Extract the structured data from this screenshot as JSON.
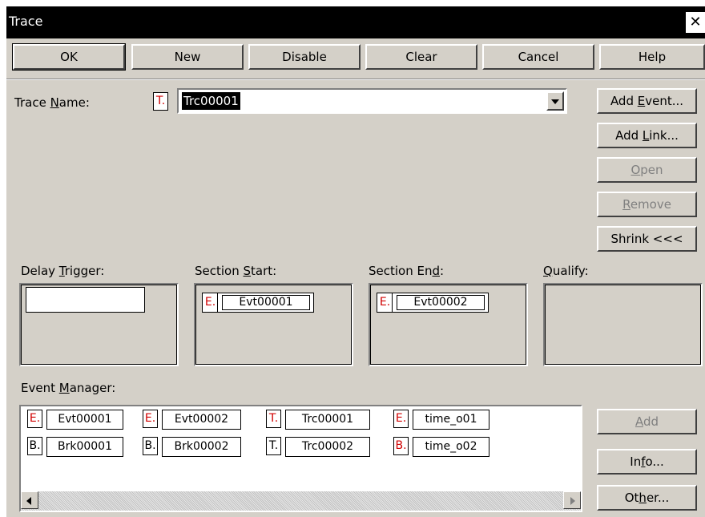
{
  "window": {
    "title": "Trace",
    "close_symbol": "✕"
  },
  "buttons": {
    "ok": "OK",
    "new": "New",
    "disable": "Disable",
    "clear": "Clear",
    "cancel": "Cancel",
    "help": "Help"
  },
  "trace_name": {
    "label_pre": "Trace ",
    "label_u": "N",
    "label_post": "ame:",
    "badge": "T.",
    "value": "Trc00001"
  },
  "side_buttons": {
    "add_event_pre": "Add ",
    "add_event_u": "E",
    "add_event_post": "vent...",
    "add_link_pre": "Add ",
    "add_link_u": "L",
    "add_link_post": "ink...",
    "open_u": "O",
    "open_post": "pen",
    "remove_u": "R",
    "remove_post": "emove",
    "shrink": "Shrink <<<"
  },
  "delay_trigger": {
    "label_pre": "Delay ",
    "label_u": "T",
    "label_post": "rigger:"
  },
  "section_start": {
    "label_pre": "Section ",
    "label_u": "S",
    "label_post": "tart:",
    "badge": "E.",
    "event": "Evt00001"
  },
  "section_end": {
    "label_pre": "Section En",
    "label_u": "d",
    "label_post": ":",
    "badge": "E.",
    "event": "Evt00002"
  },
  "qualify": {
    "label_u": "Q",
    "label_post": "ualify:"
  },
  "event_manager": {
    "label_pre": "Event ",
    "label_u": "M",
    "label_post": "anager:",
    "rows": [
      [
        {
          "badge": "E.",
          "name": "Evt00001"
        },
        {
          "badge": "E.",
          "name": "Evt00002"
        },
        {
          "badge": "T.",
          "name": "Trc00001"
        },
        {
          "badge": "E.",
          "name": "time_o01"
        }
      ],
      [
        {
          "badge": "B.",
          "name": "Brk00001"
        },
        {
          "badge": "B.",
          "name": "Brk00002"
        },
        {
          "badge": "T.",
          "name": "Trc00002"
        },
        {
          "badge": "B.",
          "name": "time_o02"
        }
      ]
    ]
  },
  "manager_buttons": {
    "add_u": "A",
    "add_post": "dd",
    "info_pre": "In",
    "info_u": "f",
    "info_post": "o...",
    "other_pre": "Ot",
    "other_u": "h",
    "other_post": "er..."
  }
}
